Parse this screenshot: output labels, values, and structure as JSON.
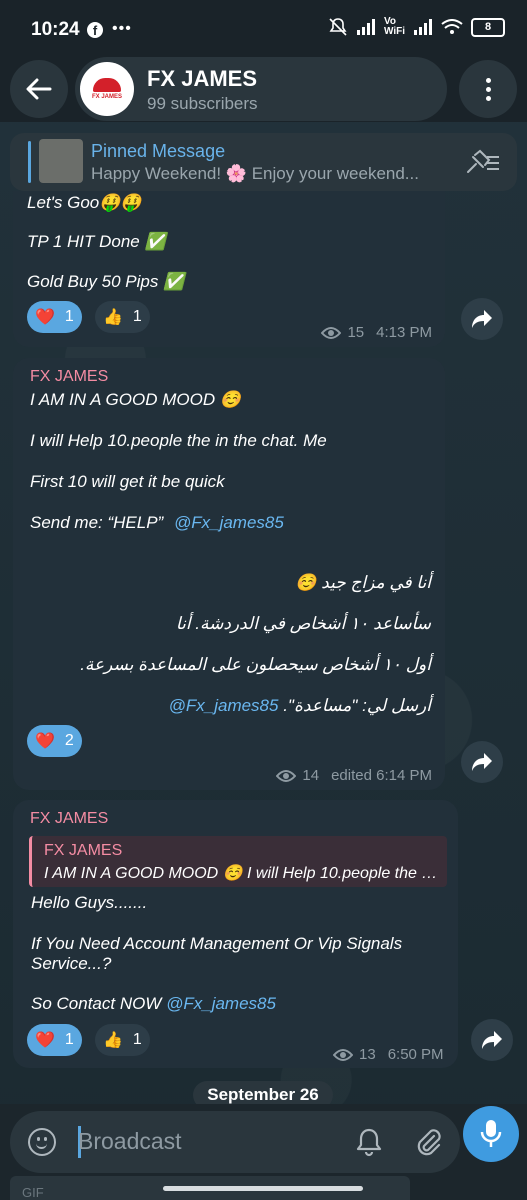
{
  "status_bar": {
    "time": "10:24",
    "vowifi_top": "Vo",
    "vowifi_bottom": "WiFi",
    "battery": "8"
  },
  "header": {
    "channel_name": "FX JAMES",
    "subscribers": "99 subscribers",
    "avatar_text": "FX JAMES"
  },
  "pinned": {
    "title": "Pinned Message",
    "text": "Happy Weekend! 🌸 Enjoy your weekend..."
  },
  "messages": [
    {
      "lines": [
        "Let's Goo🤑🤑",
        "TP 1 HIT Done ✅",
        "Gold Buy 50 Pips ✅"
      ],
      "reactions": [
        {
          "emoji": "❤️",
          "count": "1"
        },
        {
          "emoji": "👍",
          "count": "1"
        }
      ],
      "views": "15",
      "time": "4:13 PM"
    },
    {
      "author": "FX JAMES",
      "lines": [
        "I AM IN A GOOD MOOD ☺️",
        "I will Help 10.people the  in the chat. Me",
        "First 10 will get it be quick",
        "Send me: “HELP”"
      ],
      "handle": "@Fx_james85",
      "arabic": [
        "أنا في مزاج جيد ☺️",
        "سأساعد ١٠ أشخاص في الدردشة. أنا",
        "أول ١٠ أشخاص سيحصلون على المساعدة بسرعة.",
        "أرسل لي: \"مساعدة\". "
      ],
      "arabic_handle": "Fx_james85@",
      "reactions": [
        {
          "emoji": "❤️",
          "count": "2"
        }
      ],
      "views": "14",
      "time": "edited 6:14 PM"
    },
    {
      "author": "FX JAMES",
      "reply": {
        "author": "FX JAMES",
        "text": "I AM IN A GOOD MOOD ☺️  I will Help 10.people the  in..."
      },
      "lines": [
        "Hello Guys.......",
        "If You Need Account Management Or Vip Signals",
        "Service...?",
        "So Contact NOW"
      ],
      "handle": "@Fx_james85",
      "reactions": [
        {
          "emoji": "❤️",
          "count": "1"
        },
        {
          "emoji": "👍",
          "count": "1"
        }
      ],
      "views": "13",
      "time": "6:50 PM"
    }
  ],
  "date_chip": "September 26",
  "composer": {
    "placeholder": "Broadcast"
  },
  "keyboard": {
    "gif_label": "GIF"
  }
}
